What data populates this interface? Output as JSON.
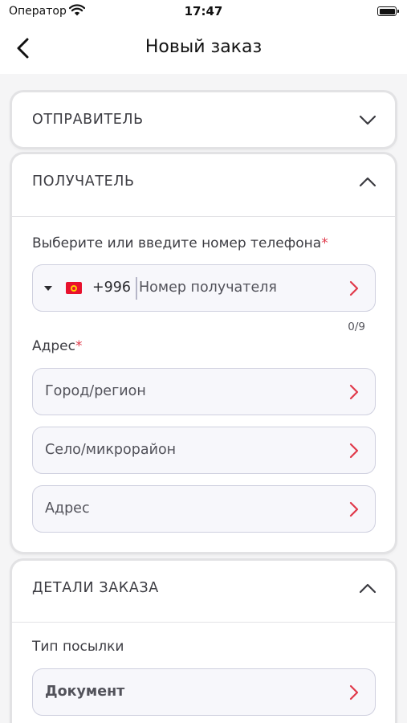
{
  "status_bar": {
    "carrier": "Оператор",
    "time": "17:47"
  },
  "nav": {
    "title": "Новый заказ",
    "back_icon": "chevron-left-icon"
  },
  "sender_section": {
    "title": "ОТПРАВИТЕЛЬ",
    "expanded": false,
    "toggle_icon": "chevron-down-icon"
  },
  "recipient_section": {
    "title": "ПОЛУЧАТЕЛЬ",
    "expanded": true,
    "toggle_icon": "chevron-up-icon",
    "phone": {
      "label": "Выберите или введите номер телефона",
      "required_mark": "*",
      "country_flag": "kyrgyzstan-flag-icon",
      "prefix": "+996",
      "placeholder": "Номер получателя",
      "counter": "0/9"
    },
    "address": {
      "label": "Адрес",
      "required_mark": "*",
      "city_placeholder": "Город/регион",
      "village_placeholder": "Село/микрорайон",
      "address_placeholder": "Адрес"
    }
  },
  "order_details_section": {
    "title": "ДЕТАЛИ ЗАКАЗА",
    "expanded": true,
    "toggle_icon": "chevron-up-icon",
    "parcel_type": {
      "label": "Тип посылки",
      "value": "Документ"
    }
  },
  "colors": {
    "accent_arrow": "#e0394a",
    "required_mark": "#e0394a",
    "input_background": "#f7f7fb",
    "input_border": "#cfd0df",
    "page_background": "#f5f5f6"
  }
}
